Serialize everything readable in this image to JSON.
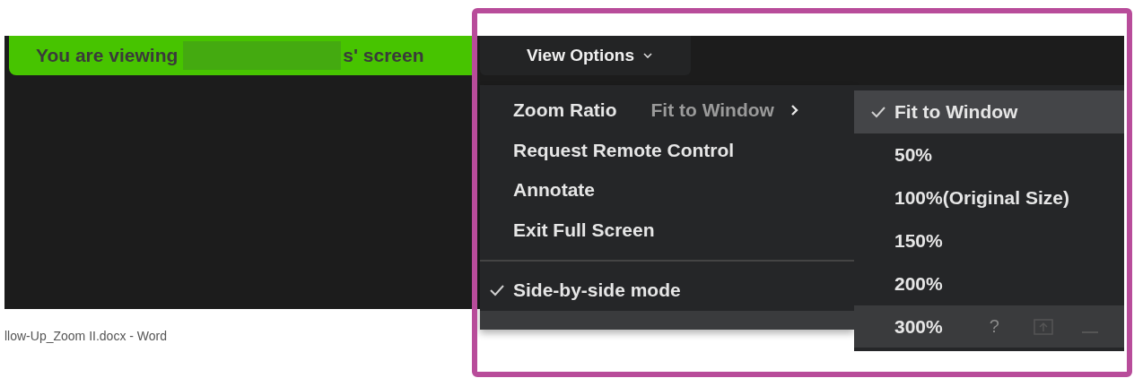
{
  "banner": {
    "prefix": "You are viewing",
    "suffix": "s' screen"
  },
  "view_options": {
    "label": "View Options"
  },
  "menu": {
    "items": [
      {
        "label": "Zoom Ratio",
        "value": "Fit to Window",
        "kind": "submenu",
        "checked": false
      },
      {
        "label": "Request Remote Control",
        "kind": "action",
        "checked": false
      },
      {
        "label": "Annotate",
        "kind": "action",
        "checked": false
      },
      {
        "label": "Exit Full Screen",
        "kind": "action",
        "checked": false
      },
      {
        "label": "Side-by-side mode",
        "kind": "toggle",
        "checked": true
      }
    ]
  },
  "submenu": {
    "items": [
      {
        "label": "Fit to Window",
        "selected": true
      },
      {
        "label": "50%",
        "selected": false
      },
      {
        "label": "100%(Original Size)",
        "selected": false
      },
      {
        "label": "150%",
        "selected": false
      },
      {
        "label": "200%",
        "selected": false
      },
      {
        "label": "300%",
        "selected": false
      }
    ]
  },
  "toolbar": {
    "help": "?"
  },
  "taskbar": {
    "title": "llow-Up_Zoom II.docx - Word"
  }
}
